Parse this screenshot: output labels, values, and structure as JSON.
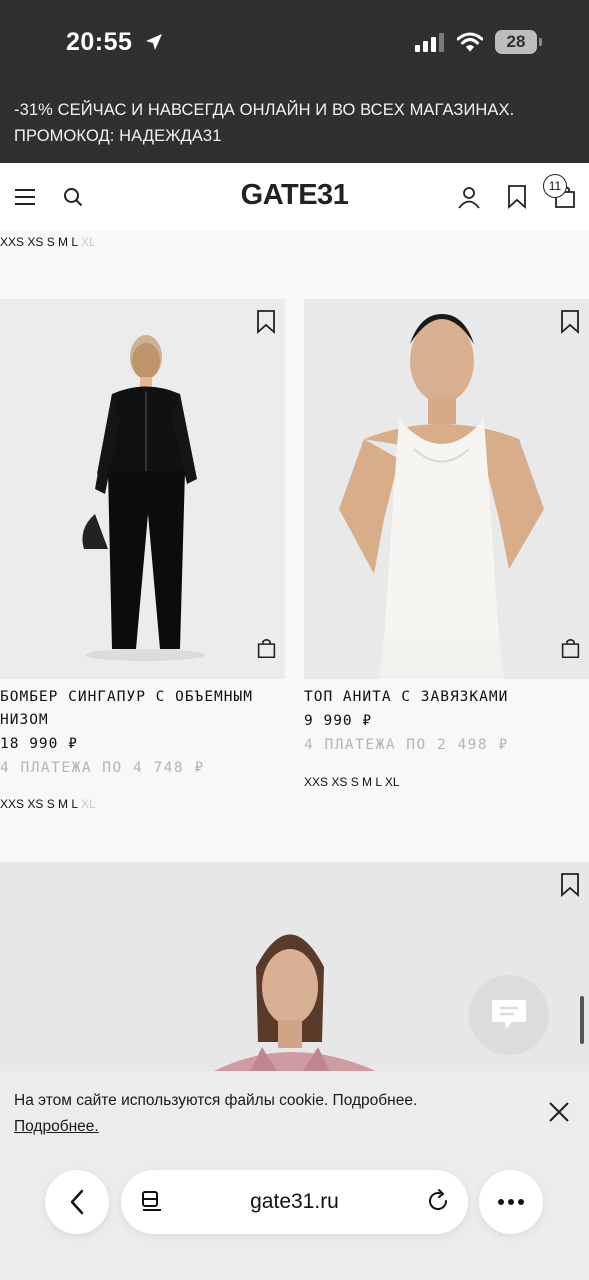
{
  "status_bar": {
    "time": "20:55",
    "battery": "28"
  },
  "promo": {
    "line1": "-31% СЕЙЧАС И НАВСЕГДА ОНЛАЙН И ВО ВСЕХ МАГАЗИНАХ.",
    "line2": "ПРОМОКОД: НАДЕЖДА31"
  },
  "header": {
    "logo": "GATE31",
    "cart_count": "11"
  },
  "top_sizes": {
    "available": "XXS XS S M L",
    "unavailable": "XL"
  },
  "products": [
    {
      "name_line1": "БОМБЕР СИНГАПУР С ОБЪЕМНЫМ",
      "name_line2": "НИЗОМ",
      "price": "18 990 ₽",
      "installments": "4 ПЛАТЕЖА ПО 4 748 ₽",
      "sizes_available": "XXS XS S M L",
      "sizes_unavailable": "XL"
    },
    {
      "name_line1": "ТОП АНИТА С ЗАВЯЗКАМИ",
      "name_line2": "",
      "price": "9 990 ₽",
      "installments": "4 ПЛАТЕЖА ПО 2 498 ₽",
      "sizes_available": "XXS XS S M L XL",
      "sizes_unavailable": ""
    }
  ],
  "cookie": {
    "text": "На этом сайте используются файлы cookie. Подробнее.",
    "link": "Подробнее."
  },
  "browser": {
    "url": "gate31.ru"
  },
  "icons": [
    "location-arrow-icon",
    "signal-icon",
    "wifi-icon",
    "menu-icon",
    "search-icon",
    "account-icon",
    "bookmark-icon",
    "cart-icon",
    "chat-icon",
    "close-icon",
    "back-icon",
    "reader-icon",
    "reload-icon",
    "more-icon"
  ]
}
